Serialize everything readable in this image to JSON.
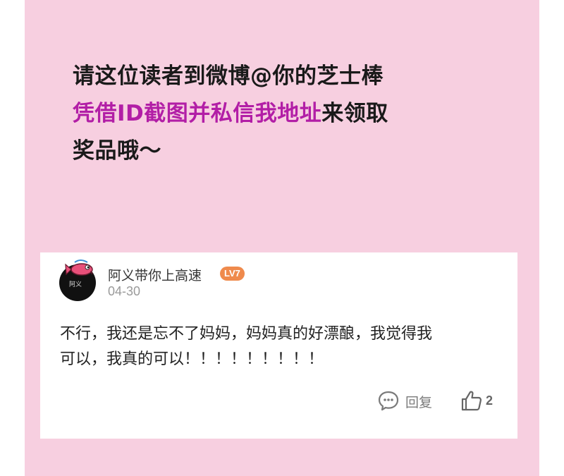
{
  "announcement": {
    "line1": "请这位读者到微博@你的芝士棒",
    "line2_highlight": "凭借ID截图并私信我地址",
    "line2_rest": "来领取",
    "line3": "奖品哦～"
  },
  "comment": {
    "username": "阿义带你上高速",
    "level": "LV7",
    "date": "04-30",
    "avatar_signature": "阿义",
    "line1": "不行，我还是忘不了妈妈，妈妈真的好漂酿，我觉得我",
    "line2": "可以，我真的可以！！！！！！！！！",
    "reply_label": "回复",
    "like_count": "2",
    "icons": {
      "reply": "comment-bubble-icon",
      "like": "thumbs-up-icon"
    }
  },
  "colors": {
    "background_panel": "#f7cfe0",
    "highlight_text": "#b21ea6",
    "level_badge": "#ef8a4c"
  }
}
